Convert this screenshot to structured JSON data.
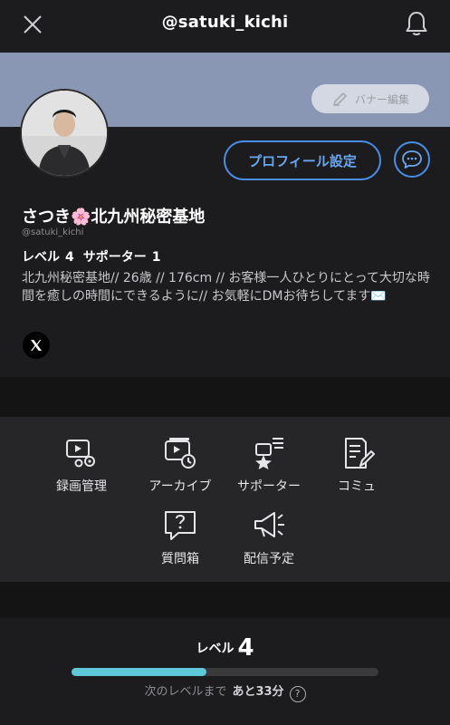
{
  "header": {
    "title": "@satuki_kichi",
    "close_icon": "close-icon",
    "bell_icon": "bell-icon"
  },
  "banner": {
    "color": "#8a97b4",
    "edit_label": "バナー編集"
  },
  "profile": {
    "settings_label": "プロフィール設定",
    "display_name": "さつき🌸北九州秘密基地",
    "handle": "@satuki_kichi",
    "level_label": "レベル",
    "level_value": "4",
    "supporter_label": "サポーター",
    "supporter_value": "1",
    "bio": "北九州秘密基地// 26歳 // 176cm // お客様一人ひとりにとって大切な時間を癒しの時間にできるように// お気軽にDMお待ちしてます✉️",
    "social": "x-icon"
  },
  "menu": {
    "items": [
      {
        "label": "録画管理",
        "icon": "video-settings-icon"
      },
      {
        "label": "アーカイブ",
        "icon": "archive-icon"
      },
      {
        "label": "サポーター",
        "icon": "supporter-icon"
      },
      {
        "label": "コミュ",
        "icon": "community-icon"
      },
      {
        "label": "質問箱",
        "icon": "question-box-icon"
      },
      {
        "label": "配信予定",
        "icon": "broadcast-schedule-icon"
      }
    ]
  },
  "level": {
    "label": "レベル",
    "value": "4",
    "progress_fraction": 0.44,
    "progress_color": "#5ec8d8",
    "next_label": "次のレベルまで",
    "remaining": "あと33分",
    "help": "?"
  },
  "colors": {
    "accent": "#4a8fe7",
    "background": "#1c1c1e"
  }
}
